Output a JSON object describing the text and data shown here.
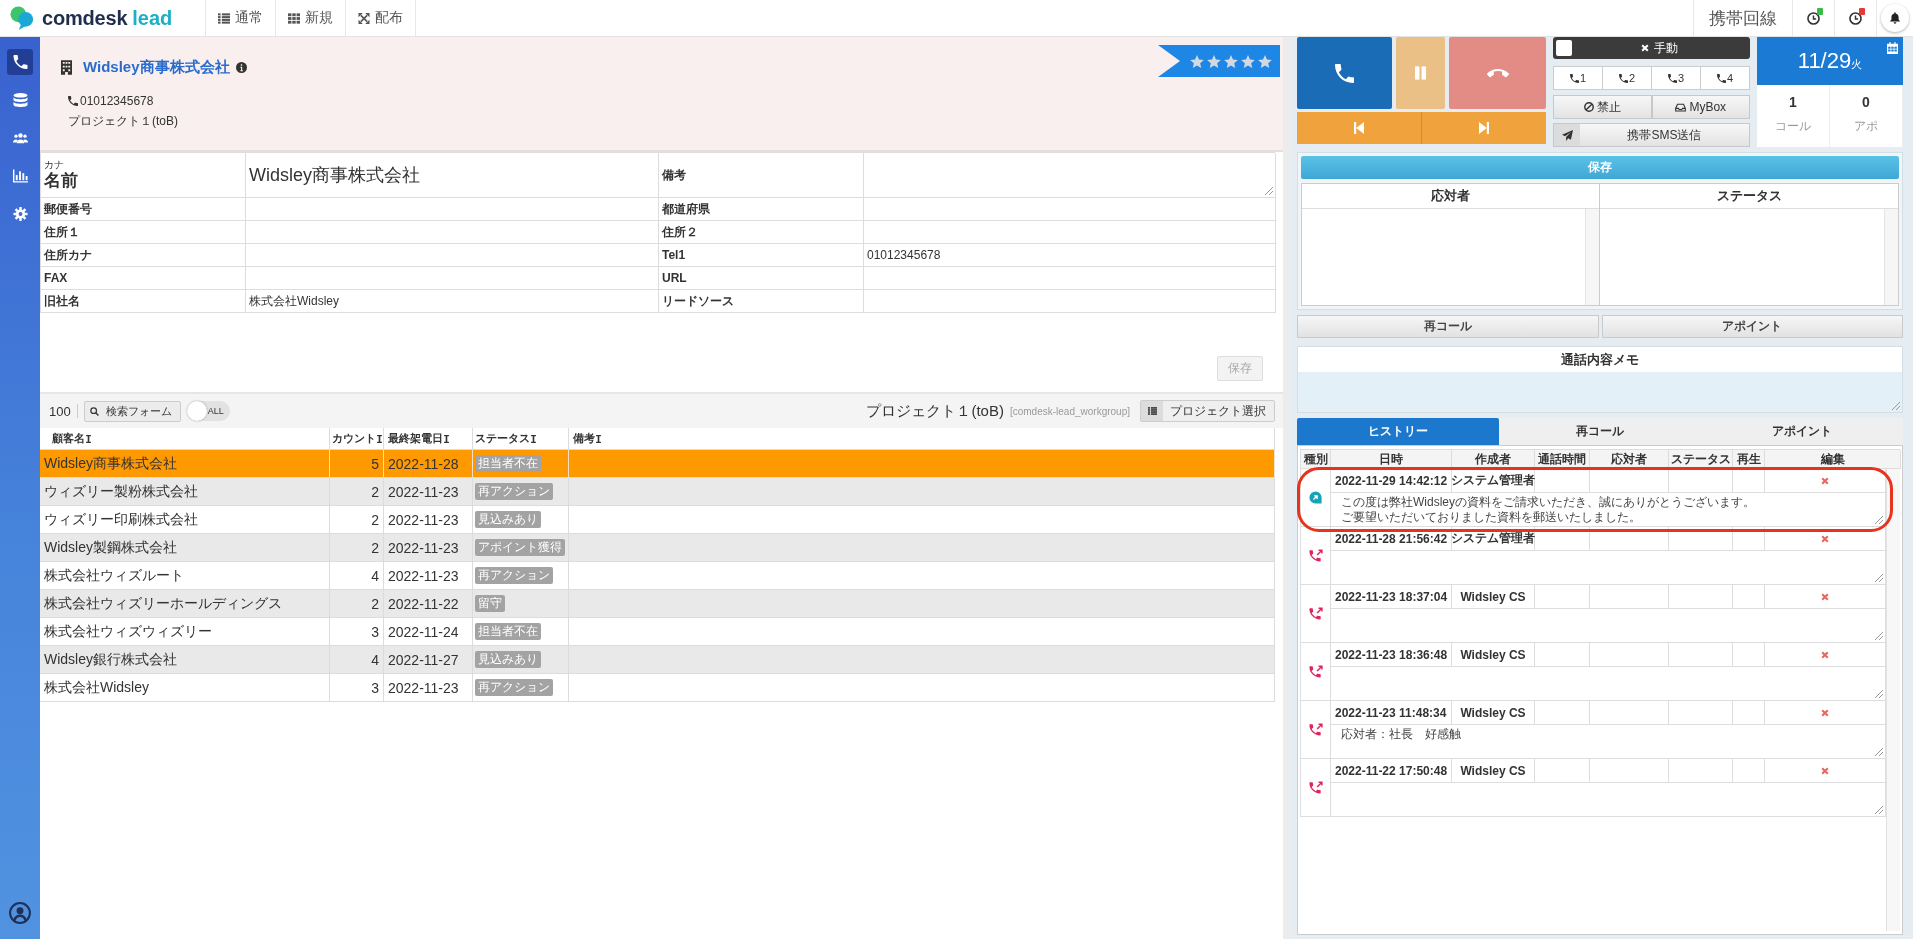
{
  "topbar": {
    "logo": {
      "name": "comdesk",
      "suffix": "lead"
    },
    "nav": [
      {
        "label": "通常"
      },
      {
        "label": "新規"
      },
      {
        "label": "配布"
      }
    ],
    "line_label": "携帯回線",
    "timers": [
      {
        "color": "#3dbb4a"
      },
      {
        "color": "#e53935"
      }
    ]
  },
  "sidebar": {
    "items": [
      {
        "selected": true
      },
      {
        "selected": false
      },
      {
        "selected": false
      },
      {
        "selected": false
      },
      {
        "selected": false
      }
    ]
  },
  "lead": {
    "title": "Widsley商事株式会社",
    "phone": "01012345678",
    "project": "プロジェクト１(toB)",
    "stars": 5
  },
  "form": {
    "rows": [
      [
        {
          "kind": "name",
          "sublabel": "カナ",
          "label": "名前",
          "value": "Widsley商事株式会社"
        },
        {
          "kind": "textarea",
          "label": "備考"
        }
      ],
      [
        {
          "kind": "text",
          "label": "郵便番号"
        },
        {
          "kind": "text",
          "label": "都道府県"
        }
      ],
      [
        {
          "kind": "text",
          "label": "住所１"
        },
        {
          "kind": "text",
          "label": "住所２"
        }
      ],
      [
        {
          "kind": "text",
          "label": "住所カナ"
        },
        {
          "kind": "text",
          "label": "Tel1",
          "value": "01012345678"
        }
      ],
      [
        {
          "kind": "text",
          "label": "FAX"
        },
        {
          "kind": "text",
          "label": "URL"
        }
      ],
      [
        {
          "kind": "text",
          "label": "旧社名",
          "value": "株式会社Widsley"
        },
        {
          "kind": "text",
          "label": "リードソース"
        }
      ]
    ],
    "save_button": {
      "label": "保存",
      "disabled": true
    }
  },
  "list": {
    "count": "100",
    "search_button": "検索フォーム",
    "all_toggle": {
      "label": "ALL",
      "on": false
    },
    "project": "プロジェクト１(toB)",
    "workgroup": "[comdesk-lead_workgroup]",
    "project_button": "プロジェクト選択",
    "columns": [
      "顧客名",
      "カウント",
      "最終架電日",
      "ステータス",
      "備考"
    ],
    "rows": [
      {
        "name": "Widsley商事株式会社",
        "count": "5",
        "date": "2022-11-28",
        "status": "担当者不在",
        "selected": true
      },
      {
        "name": "ウィズリー製粉株式会社",
        "count": "2",
        "date": "2022-11-23",
        "status": "再アクション",
        "selected": false
      },
      {
        "name": "ウィズリー印刷株式会社",
        "count": "2",
        "date": "2022-11-23",
        "status": "見込みあり",
        "selected": false
      },
      {
        "name": "Widsley製鋼株式会社",
        "count": "2",
        "date": "2022-11-23",
        "status": "アポイント獲得",
        "selected": false
      },
      {
        "name": "株式会社ウィズルート",
        "count": "4",
        "date": "2022-11-23",
        "status": "再アクション",
        "selected": false
      },
      {
        "name": "株式会社ウィズリーホールディングス",
        "count": "2",
        "date": "2022-11-22",
        "status": "留守",
        "selected": false
      },
      {
        "name": "株式会社ウィズウィズリー",
        "count": "3",
        "date": "2022-11-24",
        "status": "担当者不在",
        "selected": false
      },
      {
        "name": "Widsley銀行株式会社",
        "count": "4",
        "date": "2022-11-27",
        "status": "見込みあり",
        "selected": false
      },
      {
        "name": "株式会社Widsley",
        "count": "3",
        "date": "2022-11-23",
        "status": "再アクション",
        "selected": false
      }
    ]
  },
  "phone": {
    "manual": {
      "label": "手動",
      "checked": false
    },
    "lines": [
      "1",
      "2",
      "3",
      "4"
    ],
    "block_button": "禁止",
    "mybox_button": "MyBox",
    "sms_button": "携帯SMS送信"
  },
  "date": {
    "date": "11/29",
    "weekday": "火",
    "stats": [
      {
        "value": "1",
        "label": "コール"
      },
      {
        "value": "0",
        "label": "アポ"
      }
    ]
  },
  "response": {
    "save_button": "保存",
    "columns": [
      "応対者",
      "ステータス"
    ]
  },
  "actions": [
    "再コール",
    "アポイント"
  ],
  "memo": {
    "title": "通話内容メモ"
  },
  "history": {
    "tabs": [
      {
        "label": "ヒストリー",
        "selected": true
      },
      {
        "label": "再コール",
        "selected": false
      },
      {
        "label": "アポイント",
        "selected": false
      }
    ],
    "columns": [
      "種別",
      "日時",
      "作成者",
      "通話時間",
      "応対者",
      "ステータス",
      "再生",
      "編集"
    ],
    "records": [
      {
        "kind": "message",
        "datetime": "2022-11-29 14:42:12",
        "author": "システム管理者",
        "memo": [
          "この度は弊社Widsleyの資料をご請求いただき、誠にありがとうございます。",
          "ご要望いただいておりました資料を郵送いたしました。"
        ],
        "highlighted": true
      },
      {
        "kind": "call",
        "datetime": "2022-11-28 21:56:42",
        "author": "システム管理者",
        "highlighted": false
      },
      {
        "kind": "call",
        "datetime": "2022-11-23 18:37:04",
        "author": "Widsley CS",
        "highlighted": false
      },
      {
        "kind": "call",
        "datetime": "2022-11-23 18:36:48",
        "author": "Widsley CS",
        "highlighted": false
      },
      {
        "kind": "call",
        "datetime": "2022-11-23 11:48:34",
        "author": "Widsley CS",
        "memo": [
          "応対者：社長　好感触"
        ],
        "highlighted": false
      },
      {
        "kind": "call",
        "datetime": "2022-11-22 17:50:48",
        "author": "Widsley CS",
        "highlighted": false
      }
    ]
  }
}
